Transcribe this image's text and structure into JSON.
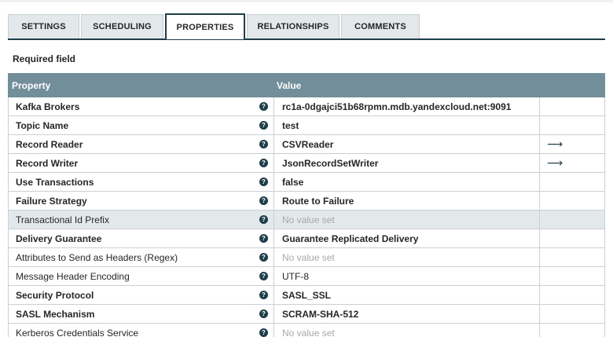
{
  "tabs": [
    {
      "label": "SETTINGS",
      "active": false
    },
    {
      "label": "SCHEDULING",
      "active": false
    },
    {
      "label": "PROPERTIES",
      "active": true
    },
    {
      "label": "RELATIONSHIPS",
      "active": false
    },
    {
      "label": "COMMENTS",
      "active": false
    }
  ],
  "required_label": "Required field",
  "table": {
    "header_property": "Property",
    "header_value": "Value",
    "rows": [
      {
        "name": "Kafka Brokers",
        "required": true,
        "value": "rc1a-0dgajci51b68rpmn.mdb.yandexcloud.net:9091",
        "empty": false,
        "goto": false
      },
      {
        "name": "Topic Name",
        "required": true,
        "value": "test",
        "empty": false,
        "goto": false
      },
      {
        "name": "Record Reader",
        "required": true,
        "value": "CSVReader",
        "empty": false,
        "goto": true
      },
      {
        "name": "Record Writer",
        "required": true,
        "value": "JsonRecordSetWriter",
        "empty": false,
        "goto": true
      },
      {
        "name": "Use Transactions",
        "required": true,
        "value": "false",
        "empty": false,
        "goto": false
      },
      {
        "name": "Failure Strategy",
        "required": true,
        "value": "Route to Failure",
        "empty": false,
        "goto": false
      },
      {
        "name": "Transactional Id Prefix",
        "required": false,
        "value": "No value set",
        "empty": true,
        "goto": false,
        "highlight": true
      },
      {
        "name": "Delivery Guarantee",
        "required": true,
        "value": "Guarantee Replicated Delivery",
        "empty": false,
        "goto": false
      },
      {
        "name": "Attributes to Send as Headers (Regex)",
        "required": false,
        "value": "No value set",
        "empty": true,
        "goto": false
      },
      {
        "name": "Message Header Encoding",
        "required": false,
        "value": "UTF-8",
        "empty": false,
        "goto": false
      },
      {
        "name": "Security Protocol",
        "required": true,
        "value": "SASL_SSL",
        "empty": false,
        "goto": false
      },
      {
        "name": "SASL Mechanism",
        "required": true,
        "value": "SCRAM-SHA-512",
        "empty": false,
        "goto": false
      },
      {
        "name": "Kerberos Credentials Service",
        "required": false,
        "value": "No value set",
        "empty": true,
        "goto": false
      }
    ]
  },
  "icons": {
    "help": "help-circle-icon",
    "goto": "arrow-right-icon"
  },
  "colors": {
    "header_bg": "#728e9b",
    "accent": "#1e3f4a",
    "highlight_row": "#e3e8eb",
    "tab_bg": "#e3e8eb"
  }
}
